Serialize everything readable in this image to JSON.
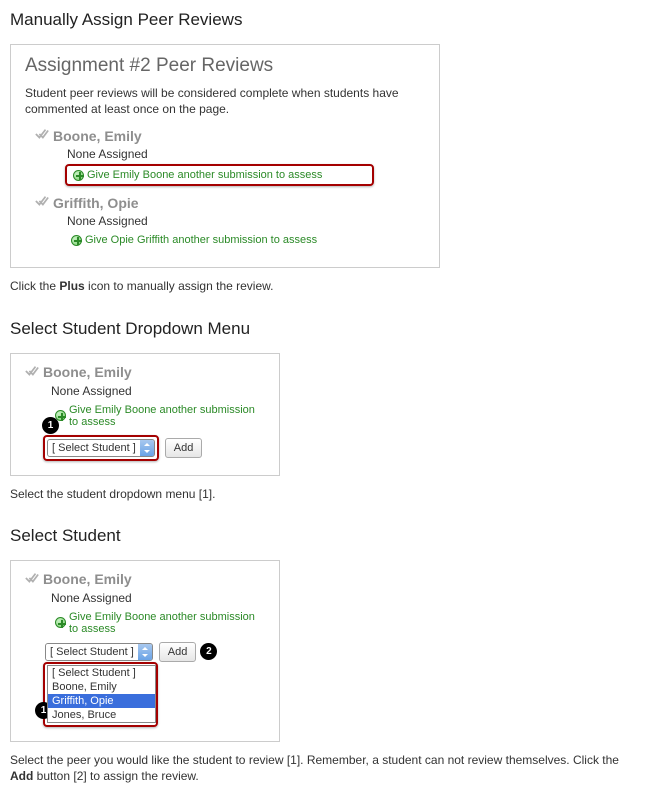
{
  "sections": {
    "manual": {
      "title": "Manually Assign Peer Reviews",
      "panel_title": "Assignment #2 Peer Reviews",
      "panel_desc": "Student peer reviews will be considered complete when students have commented at least once on the page.",
      "students": [
        {
          "name": "Boone, Emily",
          "none": "None Assigned",
          "give": "Give Emily Boone another submission to assess",
          "boxed": true
        },
        {
          "name": "Griffith, Opie",
          "none": "None Assigned",
          "give": "Give Opie Griffith another submission to assess",
          "boxed": false
        }
      ],
      "caption_pre": "Click the ",
      "caption_bold": "Plus",
      "caption_post": " icon to manually assign the review."
    },
    "dropdown": {
      "title": "Select Student Dropdown Menu",
      "student_name": "Boone, Emily",
      "none": "None Assigned",
      "give": "Give Emily Boone another submission to assess",
      "select_label": "[ Select Student ]",
      "add_label": "Add",
      "badge1": "1",
      "caption": "Select the student dropdown menu [1]."
    },
    "selectstudent": {
      "title": "Select Student",
      "student_name": "Boone, Emily",
      "none": "None Assigned",
      "give": "Give Emily Boone another submission to assess",
      "select_label": "[ Select Student ]",
      "add_label": "Add",
      "badge1": "1",
      "badge2": "2",
      "options": [
        {
          "label": "[ Select Student ]",
          "selected": false
        },
        {
          "label": "Boone, Emily",
          "selected": false
        },
        {
          "label": "Griffith, Opie",
          "selected": true
        },
        {
          "label": "Jones, Bruce",
          "selected": false
        }
      ],
      "caption_parts": {
        "p1": "Select the peer you would like the student to review [1]. Remember, a student can not review themselves. Click the ",
        "b1": "Add",
        "p2": " button [2] to assign the review."
      }
    }
  }
}
